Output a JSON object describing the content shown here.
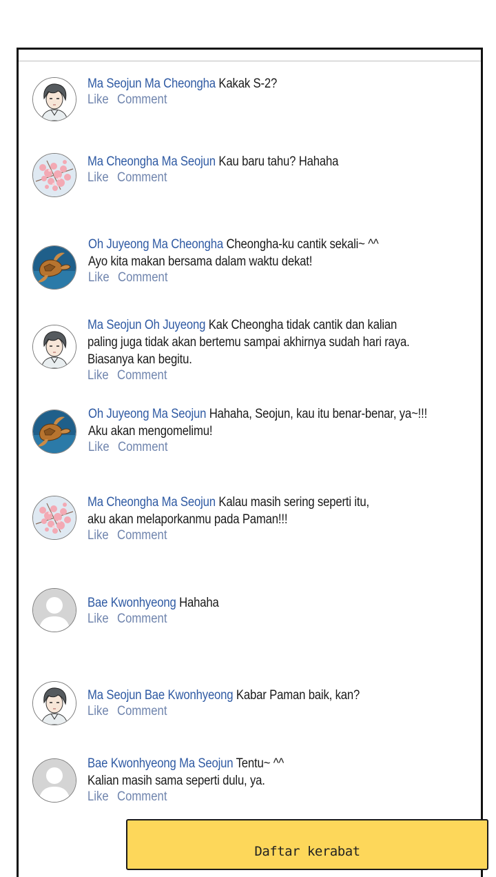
{
  "actions": {
    "like_label": "Like",
    "comment_label": "Comment"
  },
  "comments": [
    {
      "name": "Ma Seojun Ma Cheongha",
      "lines": [
        "Kakak S-2?"
      ],
      "avatar": "boy-avatar-icon"
    },
    {
      "name": "Ma Cheongha Ma Seojun",
      "lines": [
        "Kau baru tahu? Hahaha"
      ],
      "avatar": "cherry-blossom-avatar-icon"
    },
    {
      "name": "Oh Juyeong Ma Cheongha",
      "lines": [
        "Cheongha-ku cantik sekali~ ^^",
        "Ayo kita makan bersama dalam waktu dekat!"
      ],
      "avatar": "sea-turtle-avatar-icon"
    },
    {
      "name": "Ma Seojun Oh Juyeong",
      "lines": [
        "Kak Cheongha tidak cantik dan kalian",
        "paling juga tidak akan bertemu sampai akhirnya sudah hari raya.",
        "Biasanya kan begitu."
      ],
      "avatar": "boy-avatar-icon"
    },
    {
      "name": "Oh Juyeong Ma Seojun",
      "lines": [
        "Hahaha, Seojun, kau itu benar-benar, ya~!!!",
        "Aku akan mengomelimu!"
      ],
      "avatar": "sea-turtle-avatar-icon"
    },
    {
      "name": "Ma Cheongha Ma Seojun",
      "lines": [
        "Kalau masih sering seperti itu,",
        "aku akan melaporkanmu pada Paman!!!"
      ],
      "avatar": "cherry-blossom-avatar-icon"
    },
    {
      "name": "Bae Kwonhyeong",
      "lines": [
        "Hahaha"
      ],
      "avatar": "default-user-avatar-icon"
    },
    {
      "name": "Ma Seojun Bae Kwonhyeong",
      "lines": [
        "Kabar Paman baik, kan?"
      ],
      "avatar": "boy-avatar-icon"
    },
    {
      "name": "Bae Kwonhyeong Ma Seojun",
      "lines": [
        "Tentu~ ^^",
        "Kalian masih sama seperti dulu, ya."
      ],
      "avatar": "default-user-avatar-icon"
    }
  ],
  "yellow_card": {
    "title": "Daftar kerabat"
  },
  "colors": {
    "name": "#2f5aa3",
    "actions": "#6f84ad",
    "card": "#fdd75a"
  }
}
